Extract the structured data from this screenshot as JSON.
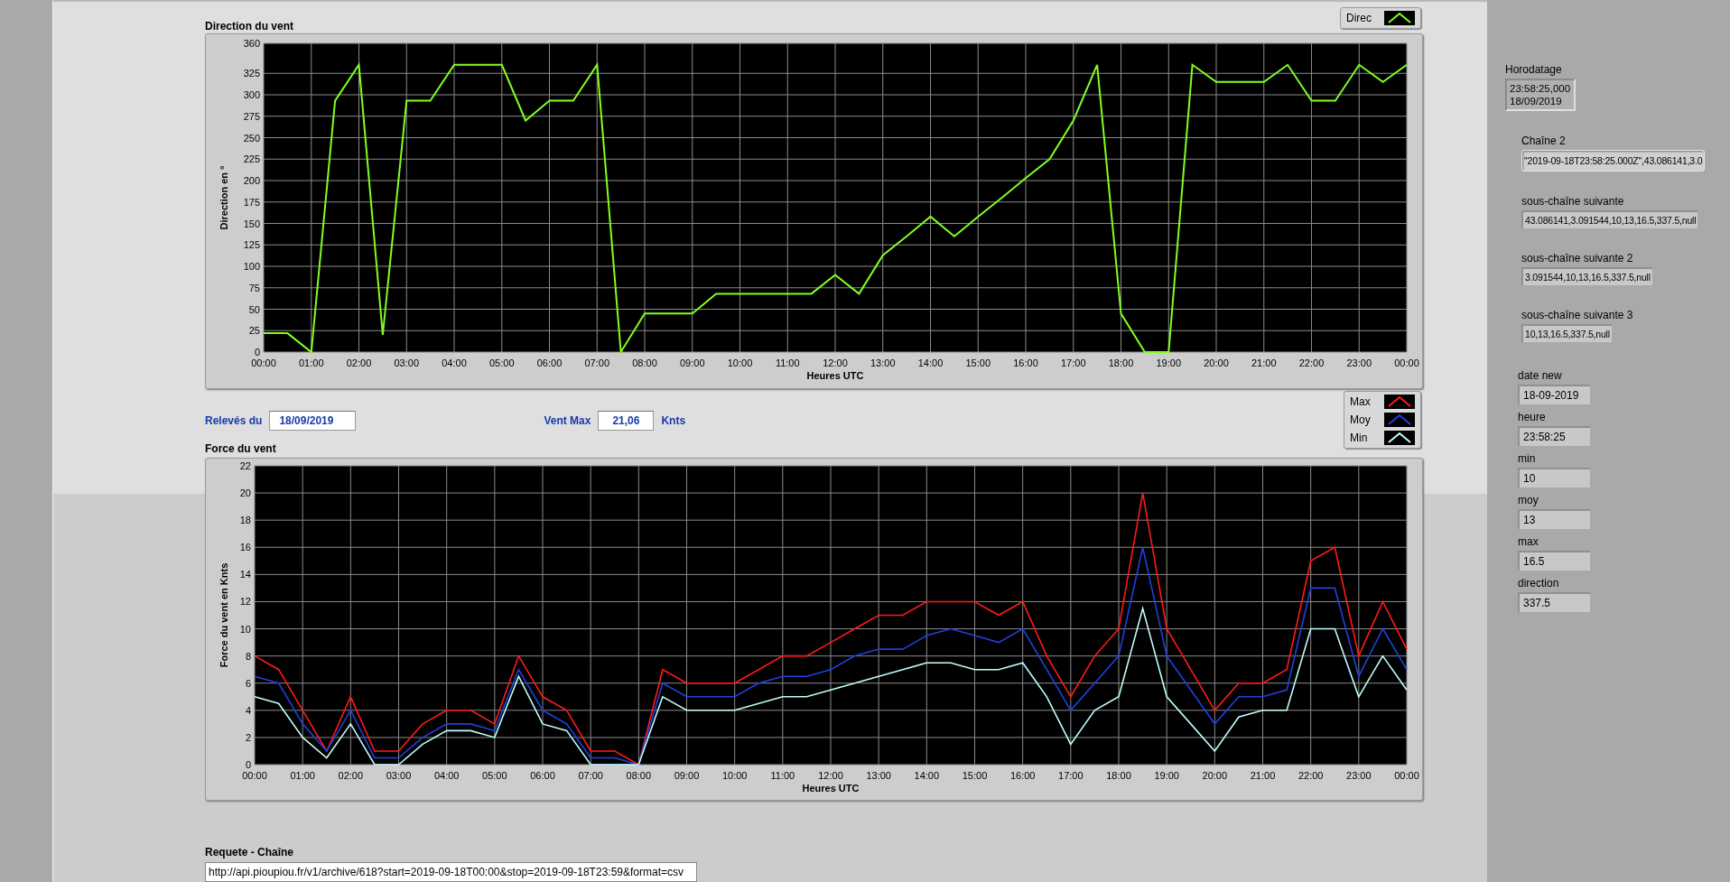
{
  "direction_panel": {
    "title": "Direction du vent",
    "chart_data": {
      "type": "line",
      "grid": true,
      "xlabel": "Heures UTC",
      "ylabel": "Direction en °",
      "x": [
        0,
        0.5,
        1,
        1.5,
        2,
        2.5,
        3,
        3.5,
        4,
        4.5,
        5,
        5.5,
        6,
        6.5,
        7,
        7.5,
        8,
        8.5,
        9,
        9.5,
        10,
        10.5,
        11,
        11.5,
        12,
        12.5,
        13,
        13.5,
        14,
        14.5,
        15,
        15.5,
        16,
        16.5,
        17,
        17.5,
        18,
        18.5,
        19,
        19.5,
        20,
        20.5,
        21,
        21.5,
        22,
        22.5,
        23,
        23.5,
        24
      ],
      "series": [
        {
          "name": "Direc",
          "color": "#80ff20",
          "values": [
            22,
            22,
            0,
            293,
            335,
            20,
            293,
            293,
            335,
            335,
            335,
            270,
            293,
            293,
            335,
            0,
            45,
            45,
            45,
            68,
            68,
            68,
            68,
            68,
            90,
            68,
            113,
            135,
            158,
            135,
            158,
            180,
            203,
            225,
            270,
            335,
            45,
            0,
            0,
            335,
            315,
            315,
            315,
            335,
            293,
            293,
            335,
            315,
            335
          ]
        }
      ],
      "xlim": [
        0,
        24
      ],
      "ylim": [
        0,
        360
      ],
      "xticks": [
        {
          "value": 0,
          "label": "00:00"
        },
        {
          "value": 1,
          "label": "01:00"
        },
        {
          "value": 2,
          "label": "02:00"
        },
        {
          "value": 3,
          "label": "03:00"
        },
        {
          "value": 4,
          "label": "04:00"
        },
        {
          "value": 5,
          "label": "05:00"
        },
        {
          "value": 6,
          "label": "06:00"
        },
        {
          "value": 7,
          "label": "07:00"
        },
        {
          "value": 8,
          "label": "08:00"
        },
        {
          "value": 9,
          "label": "09:00"
        },
        {
          "value": 10,
          "label": "10:00"
        },
        {
          "value": 11,
          "label": "11:00"
        },
        {
          "value": 12,
          "label": "12:00"
        },
        {
          "value": 13,
          "label": "13:00"
        },
        {
          "value": 14,
          "label": "14:00"
        },
        {
          "value": 15,
          "label": "15:00"
        },
        {
          "value": 16,
          "label": "16:00"
        },
        {
          "value": 17,
          "label": "17:00"
        },
        {
          "value": 18,
          "label": "18:00"
        },
        {
          "value": 19,
          "label": "19:00"
        },
        {
          "value": 20,
          "label": "20:00"
        },
        {
          "value": 21,
          "label": "21:00"
        },
        {
          "value": 22,
          "label": "22:00"
        },
        {
          "value": 23,
          "label": "23:00"
        },
        {
          "value": 24,
          "label": "00:00"
        }
      ],
      "yticks": [
        0,
        25,
        50,
        75,
        100,
        125,
        150,
        175,
        200,
        225,
        250,
        275,
        300,
        325,
        360
      ]
    }
  },
  "readings": {
    "date_label": "Relevés du",
    "date_value": "18/09/2019",
    "max_label": "Vent Max",
    "max_value": "21,06",
    "max_unit": "Knts"
  },
  "force_panel": {
    "title": "Force du vent",
    "chart_data": {
      "type": "line",
      "grid": true,
      "xlabel": "Heures UTC",
      "ylabel": "Force du vent en Knts",
      "x": [
        0,
        0.5,
        1,
        1.5,
        2,
        2.5,
        3,
        3.5,
        4,
        4.5,
        5,
        5.5,
        6,
        6.5,
        7,
        7.5,
        8,
        8.5,
        9,
        9.5,
        10,
        10.5,
        11,
        11.5,
        12,
        12.5,
        13,
        13.5,
        14,
        14.5,
        15,
        15.5,
        16,
        16.5,
        17,
        17.5,
        18,
        18.5,
        19,
        19.5,
        20,
        20.5,
        21,
        21.5,
        22,
        22.5,
        23,
        23.5,
        24
      ],
      "series": [
        {
          "name": "Max",
          "color": "#ff1a1a",
          "values": [
            8,
            7,
            4,
            1,
            5,
            1,
            1,
            3,
            4,
            4,
            3,
            8,
            5,
            4,
            1,
            1,
            0,
            7,
            6,
            6,
            6,
            7,
            8,
            8,
            9,
            10,
            11,
            11,
            12,
            12,
            12,
            11,
            12,
            8,
            5,
            8,
            10,
            20,
            10,
            7,
            4,
            6,
            6,
            7,
            15,
            16,
            8,
            12,
            8.5
          ]
        },
        {
          "name": "Moy",
          "color": "#2040e0",
          "values": [
            6.5,
            6,
            3,
            1,
            4,
            0.5,
            0.5,
            2,
            3,
            3,
            2.5,
            7,
            4,
            3,
            0.5,
            0.5,
            0,
            6,
            5,
            5,
            5,
            6,
            6.5,
            6.5,
            7,
            8,
            8.5,
            8.5,
            9.5,
            10,
            9.5,
            9,
            10,
            7,
            4,
            6,
            8,
            16,
            8,
            5.5,
            3,
            5,
            5,
            5.5,
            13,
            13,
            6.5,
            10,
            7
          ]
        },
        {
          "name": "Min",
          "color": "#c0ffff",
          "values": [
            5,
            4.5,
            2,
            0.5,
            3,
            0,
            0,
            1.5,
            2.5,
            2.5,
            2,
            6.5,
            3,
            2.5,
            0,
            0,
            0,
            5,
            4,
            4,
            4,
            4.5,
            5,
            5,
            5.5,
            6,
            6.5,
            7,
            7.5,
            7.5,
            7,
            7,
            7.5,
            5,
            1.5,
            4,
            5,
            11.5,
            5,
            3,
            1,
            3.5,
            4,
            4,
            10,
            10,
            5,
            8,
            5.5
          ]
        }
      ],
      "xlim": [
        0,
        24
      ],
      "ylim": [
        0,
        22
      ],
      "xticks": [
        {
          "value": 0,
          "label": "00:00"
        },
        {
          "value": 1,
          "label": "01:00"
        },
        {
          "value": 2,
          "label": "02:00"
        },
        {
          "value": 3,
          "label": "03:00"
        },
        {
          "value": 4,
          "label": "04:00"
        },
        {
          "value": 5,
          "label": "05:00"
        },
        {
          "value": 6,
          "label": "06:00"
        },
        {
          "value": 7,
          "label": "07:00"
        },
        {
          "value": 8,
          "label": "08:00"
        },
        {
          "value": 9,
          "label": "09:00"
        },
        {
          "value": 10,
          "label": "10:00"
        },
        {
          "value": 11,
          "label": "11:00"
        },
        {
          "value": 12,
          "label": "12:00"
        },
        {
          "value": 13,
          "label": "13:00"
        },
        {
          "value": 14,
          "label": "14:00"
        },
        {
          "value": 15,
          "label": "15:00"
        },
        {
          "value": 16,
          "label": "16:00"
        },
        {
          "value": 17,
          "label": "17:00"
        },
        {
          "value": 18,
          "label": "18:00"
        },
        {
          "value": 19,
          "label": "19:00"
        },
        {
          "value": 20,
          "label": "20:00"
        },
        {
          "value": 21,
          "label": "21:00"
        },
        {
          "value": 22,
          "label": "22:00"
        },
        {
          "value": 23,
          "label": "23:00"
        },
        {
          "value": 24,
          "label": "00:00"
        }
      ],
      "yticks": [
        0,
        2,
        4,
        6,
        8,
        10,
        12,
        14,
        16,
        18,
        20,
        22
      ]
    }
  },
  "request": {
    "label": "Requete - Chaîne",
    "value": "http://api.pioupiou.fr/v1/archive/618?start=2019-09-18T00:00&stop=2019-09-18T23:59&format=csv"
  },
  "side_panel": {
    "timestamp": {
      "label": "Horodatage",
      "lines": [
        "23:58:25,000",
        "18/09/2019"
      ]
    },
    "strings": [
      {
        "label": "Chaîne 2",
        "value": "\"2019-09-18T23:58:25.000Z\",43.086141,3.0",
        "kind": "control"
      },
      {
        "label": "sous-chaîne suivante",
        "value": "43.086141,3.091544,10,13,16.5,337.5,null",
        "kind": "indicator"
      },
      {
        "label": "sous-chaîne suivante 2",
        "value": "3.091544,10,13,16.5,337.5,null",
        "kind": "indicator"
      },
      {
        "label": "sous-chaîne suivante 3",
        "value": "10,13,16.5,337.5,null",
        "kind": "indicator"
      }
    ],
    "values": [
      {
        "label": "date new",
        "value": "18-09-2019"
      },
      {
        "label": "heure",
        "value": "23:58:25"
      },
      {
        "label": "min",
        "value": "10"
      },
      {
        "label": "moy",
        "value": "13"
      },
      {
        "label": "max",
        "value": "16.5"
      },
      {
        "label": "direction",
        "value": "337.5"
      }
    ]
  }
}
